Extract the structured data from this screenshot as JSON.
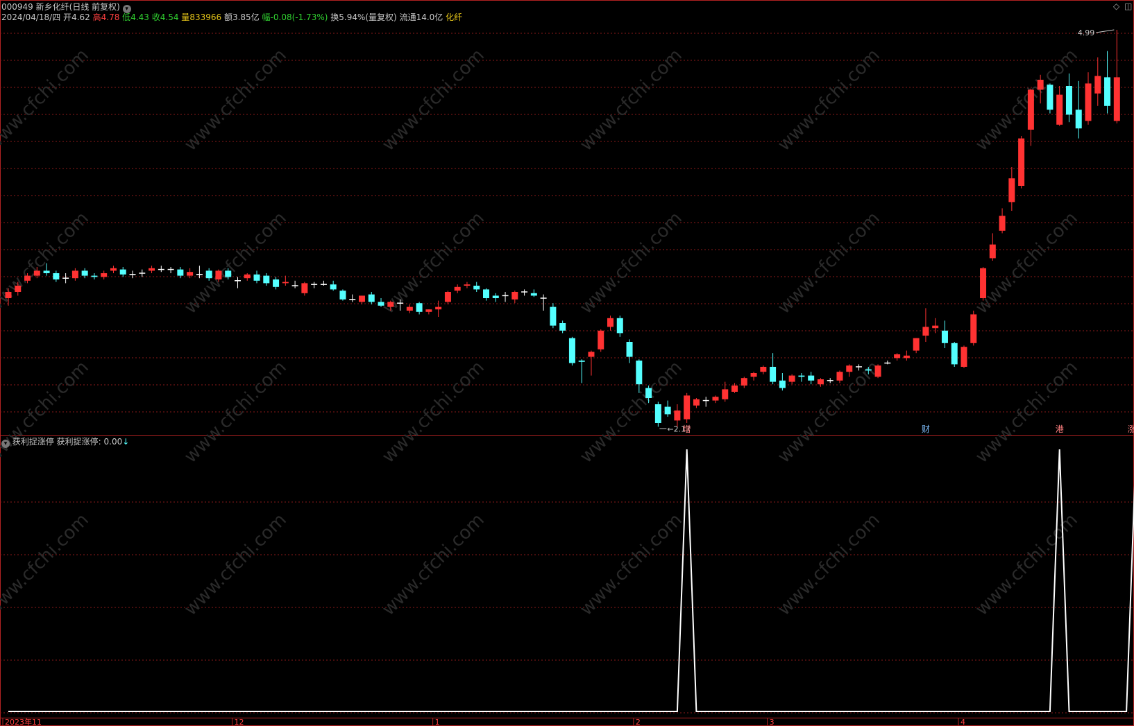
{
  "header": {
    "code": "000949",
    "name": "新乡化纤",
    "period": "(日线 前复权)",
    "date": "2024/04/18/四",
    "open_label": "开",
    "open": "4.62",
    "high_label": "高",
    "high": "4.78",
    "low_label": "低",
    "low": "4.43",
    "close_label": "收",
    "close": "4.54",
    "vol_label": "量",
    "vol": "833966",
    "amt_label": "额",
    "amt": "3.85亿",
    "chg_label": "幅",
    "chg": "-0.08(-1.73%)",
    "turnover": "换5.94%(量复权)",
    "float": "流通14.0亿",
    "sector": "化纤"
  },
  "indicator": {
    "name": "获利捉涨停",
    "value_label": "获利捉涨停: 0.00",
    "arrow": "↓"
  },
  "watermark": "www.cfchi.com",
  "annotations": {
    "max_label": "4.99",
    "min_label": "2.17",
    "tags": [
      "增",
      "财",
      "港",
      "涨停"
    ]
  },
  "x_axis_labels": [
    "2023年11",
    "12",
    "1",
    "2",
    "3",
    "4"
  ],
  "colors": {
    "up": "#ff3232",
    "down": "#54ffff",
    "doji": "#ffffff",
    "grid": "#8b1a1a",
    "line": "#ffffff"
  },
  "chart_data": {
    "type": "candlestick",
    "series_name": "",
    "ohlc": [
      [
        3.2,
        3.25,
        3.14,
        3.28
      ],
      [
        3.25,
        3.3,
        3.22,
        3.33
      ],
      [
        3.34,
        3.38,
        3.32,
        3.4
      ],
      [
        3.38,
        3.42,
        3.36,
        3.45
      ],
      [
        3.42,
        3.4,
        3.38,
        3.48
      ],
      [
        3.4,
        3.35,
        3.33,
        3.42
      ],
      [
        3.36,
        3.36,
        3.32,
        3.4
      ],
      [
        3.36,
        3.42,
        3.34,
        3.44
      ],
      [
        3.42,
        3.38,
        3.36,
        3.44
      ],
      [
        3.38,
        3.37,
        3.35,
        3.4
      ],
      [
        3.37,
        3.4,
        3.35,
        3.42
      ],
      [
        3.42,
        3.44,
        3.4,
        3.46
      ],
      [
        3.43,
        3.39,
        3.37,
        3.45
      ],
      [
        3.39,
        3.39,
        3.36,
        3.42
      ],
      [
        3.4,
        3.4,
        3.37,
        3.43
      ],
      [
        3.42,
        3.44,
        3.4,
        3.46
      ],
      [
        3.43,
        3.43,
        3.41,
        3.46
      ],
      [
        3.43,
        3.43,
        3.4,
        3.45
      ],
      [
        3.43,
        3.38,
        3.36,
        3.45
      ],
      [
        3.38,
        3.41,
        3.36,
        3.44
      ],
      [
        3.39,
        3.39,
        3.36,
        3.46
      ],
      [
        3.42,
        3.36,
        3.34,
        3.44
      ],
      [
        3.35,
        3.42,
        3.33,
        3.43
      ],
      [
        3.42,
        3.37,
        3.35,
        3.44
      ],
      [
        3.34,
        3.34,
        3.28,
        3.37
      ],
      [
        3.36,
        3.39,
        3.34,
        3.4
      ],
      [
        3.39,
        3.34,
        3.32,
        3.42
      ],
      [
        3.38,
        3.32,
        3.3,
        3.4
      ],
      [
        3.35,
        3.29,
        3.27,
        3.37
      ],
      [
        3.32,
        3.33,
        3.3,
        3.38
      ],
      [
        3.3,
        3.3,
        3.28,
        3.34
      ],
      [
        3.24,
        3.32,
        3.22,
        3.33
      ],
      [
        3.31,
        3.31,
        3.28,
        3.33
      ],
      [
        3.31,
        3.31,
        3.3,
        3.34
      ],
      [
        3.31,
        3.27,
        3.26,
        3.34
      ],
      [
        3.26,
        3.19,
        3.18,
        3.27
      ],
      [
        3.19,
        3.19,
        3.17,
        3.23
      ],
      [
        3.17,
        3.22,
        3.15,
        3.22
      ],
      [
        3.23,
        3.17,
        3.15,
        3.25
      ],
      [
        3.17,
        3.14,
        3.13,
        3.2
      ],
      [
        3.13,
        3.17,
        3.1,
        3.18
      ],
      [
        3.16,
        3.16,
        3.1,
        3.19
      ],
      [
        3.1,
        3.13,
        3.08,
        3.15
      ],
      [
        3.16,
        3.09,
        3.07,
        3.17
      ],
      [
        3.09,
        3.11,
        3.07,
        3.11
      ],
      [
        3.11,
        3.13,
        3.05,
        3.18
      ],
      [
        3.17,
        3.25,
        3.15,
        3.26
      ],
      [
        3.26,
        3.29,
        3.24,
        3.31
      ],
      [
        3.3,
        3.31,
        3.28,
        3.33
      ],
      [
        3.3,
        3.27,
        3.25,
        3.33
      ],
      [
        3.27,
        3.2,
        3.18,
        3.28
      ],
      [
        3.22,
        3.2,
        3.17,
        3.24
      ],
      [
        3.22,
        3.22,
        3.17,
        3.25
      ],
      [
        3.19,
        3.25,
        3.16,
        3.26
      ],
      [
        3.25,
        3.25,
        3.22,
        3.27
      ],
      [
        3.24,
        3.22,
        3.21,
        3.27
      ],
      [
        3.2,
        3.2,
        3.1,
        3.23
      ],
      [
        3.13,
        2.98,
        2.96,
        3.16
      ],
      [
        3.0,
        2.94,
        2.92,
        3.02
      ],
      [
        2.88,
        2.68,
        2.66,
        2.89
      ],
      [
        2.7,
        2.69,
        2.52,
        2.71
      ],
      [
        2.73,
        2.77,
        2.58,
        2.78
      ],
      [
        2.79,
        2.94,
        2.77,
        2.95
      ],
      [
        2.97,
        3.04,
        2.94,
        3.06
      ],
      [
        3.04,
        2.92,
        2.89,
        3.06
      ],
      [
        2.85,
        2.73,
        2.68,
        2.87
      ],
      [
        2.7,
        2.51,
        2.44,
        2.71
      ],
      [
        2.48,
        2.4,
        2.36,
        2.5
      ],
      [
        2.35,
        2.2,
        2.17,
        2.37
      ],
      [
        2.33,
        2.27,
        2.25,
        2.38
      ],
      [
        2.22,
        2.3,
        2.17,
        2.35
      ],
      [
        2.23,
        2.42,
        2.2,
        2.44
      ],
      [
        2.34,
        2.39,
        2.32,
        2.4
      ],
      [
        2.38,
        2.38,
        2.33,
        2.41
      ],
      [
        2.38,
        2.41,
        2.36,
        2.42
      ],
      [
        2.39,
        2.47,
        2.37,
        2.53
      ],
      [
        2.45,
        2.5,
        2.44,
        2.52
      ],
      [
        2.5,
        2.56,
        2.48,
        2.57
      ],
      [
        2.57,
        2.6,
        2.54,
        2.61
      ],
      [
        2.61,
        2.65,
        2.59,
        2.66
      ],
      [
        2.65,
        2.53,
        2.51,
        2.76
      ],
      [
        2.54,
        2.48,
        2.46,
        2.6
      ],
      [
        2.53,
        2.58,
        2.51,
        2.59
      ],
      [
        2.58,
        2.57,
        2.53,
        2.6
      ],
      [
        2.58,
        2.54,
        2.51,
        2.61
      ],
      [
        2.51,
        2.55,
        2.49,
        2.56
      ],
      [
        2.54,
        2.54,
        2.52,
        2.56
      ],
      [
        2.54,
        2.61,
        2.52,
        2.62
      ],
      [
        2.61,
        2.66,
        2.57,
        2.67
      ],
      [
        2.65,
        2.65,
        2.62,
        2.67
      ],
      [
        2.63,
        2.62,
        2.59,
        2.65
      ],
      [
        2.57,
        2.66,
        2.56,
        2.67
      ],
      [
        2.68,
        2.68,
        2.67,
        2.7
      ],
      [
        2.72,
        2.75,
        2.7,
        2.76
      ],
      [
        2.72,
        2.74,
        2.7,
        2.78
      ],
      [
        2.78,
        2.88,
        2.76,
        2.88
      ],
      [
        2.9,
        2.97,
        2.85,
        3.12
      ],
      [
        2.96,
        2.98,
        2.92,
        3.04
      ],
      [
        2.94,
        2.84,
        2.8,
        3.02
      ],
      [
        2.84,
        2.67,
        2.65,
        2.85
      ],
      [
        2.65,
        2.81,
        2.64,
        2.82
      ],
      [
        2.84,
        3.07,
        2.82,
        3.1
      ],
      [
        3.2,
        3.44,
        3.18,
        3.45
      ],
      [
        3.52,
        3.63,
        3.5,
        3.72
      ],
      [
        3.74,
        3.86,
        3.72,
        3.92
      ],
      [
        3.97,
        4.16,
        3.9,
        4.25
      ],
      [
        4.1,
        4.48,
        4.08,
        4.5
      ],
      [
        4.55,
        4.87,
        4.42,
        4.88
      ],
      [
        4.87,
        4.95,
        4.76,
        4.99
      ],
      [
        4.91,
        4.71,
        4.68,
        4.92
      ],
      [
        4.59,
        4.83,
        4.58,
        4.9
      ],
      [
        4.9,
        4.67,
        4.61,
        5.0
      ],
      [
        4.71,
        4.56,
        4.48,
        4.94
      ],
      [
        4.62,
        4.92,
        4.59,
        5.01
      ],
      [
        4.84,
        4.98,
        4.74,
        5.13
      ],
      [
        4.97,
        4.74,
        4.68,
        5.18
      ],
      [
        4.62,
        4.97,
        4.6,
        5.35
      ]
    ],
    "indicator_name": "获利捉涨停",
    "indicator_values": [
      0,
      0,
      0,
      0,
      0,
      0,
      0,
      0,
      0,
      0,
      0,
      0,
      0,
      0,
      0,
      0,
      0,
      0,
      0,
      0,
      0,
      0,
      0,
      0,
      0,
      0,
      0,
      0,
      0,
      0,
      0,
      0,
      0,
      0,
      0,
      0,
      0,
      0,
      0,
      0,
      0,
      0,
      0,
      0,
      0,
      0,
      0,
      0,
      0,
      0,
      0,
      0,
      0,
      0,
      0,
      0,
      0,
      0,
      0,
      0,
      0,
      0,
      0,
      0,
      0,
      0,
      0,
      0,
      0,
      0,
      0,
      1,
      0,
      0,
      0,
      0,
      0,
      0,
      0,
      0,
      0,
      0,
      0,
      0,
      0,
      0,
      0,
      0,
      0,
      0,
      0,
      0,
      0,
      0,
      0,
      0,
      0,
      0,
      0,
      0,
      0,
      0,
      0,
      0,
      0,
      0,
      0,
      0,
      0,
      0,
      1,
      0,
      0,
      0,
      0,
      0,
      0,
      0,
      1
    ],
    "price_range": [
      2.1,
      5.4
    ],
    "indicator_range": [
      0,
      1
    ]
  }
}
